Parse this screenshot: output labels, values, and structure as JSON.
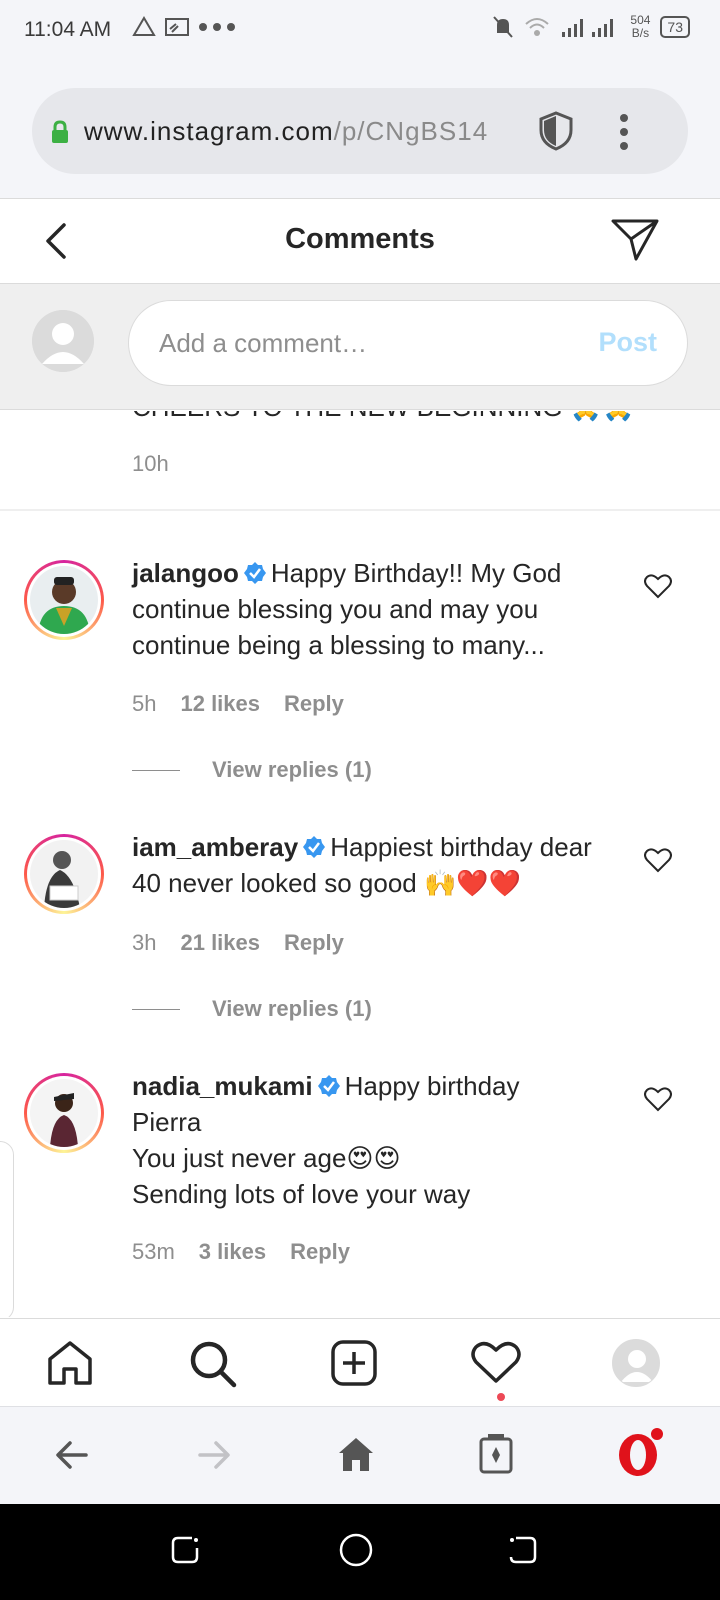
{
  "status_bar": {
    "time": "11:04 AM",
    "net_speed_value": "504",
    "net_speed_unit": "B/s",
    "battery": "73"
  },
  "browser": {
    "url_main": "www.instagram.com",
    "url_path": "/p/CNgBS14"
  },
  "header": {
    "title": "Comments"
  },
  "comment_input": {
    "placeholder": "Add a comment…",
    "post_label": "Post"
  },
  "truncated_comment": {
    "text": "CHEERS TO THE NEW BEGINNING 🙏🙏",
    "time": "10h"
  },
  "comments": [
    {
      "username": "jalangoo",
      "verified": true,
      "text": "Happy Birthday!! My God continue blessing you and may you continue being a blessing to many...",
      "time": "5h",
      "likes": "12 likes",
      "reply_label": "Reply",
      "view_replies": "View replies (1)"
    },
    {
      "username": "iam_amberay",
      "verified": true,
      "text": "Happiest birthday dear 40 never looked so good 🙌❤️❤️",
      "time": "3h",
      "likes": "21 likes",
      "reply_label": "Reply",
      "view_replies": "View replies (1)"
    },
    {
      "username": "nadia_mukami",
      "verified": true,
      "text_line1": "Happy birthday",
      "text_line2": "Pierra",
      "text_line3": "You just never age😍😍",
      "text_line4": "Sending lots of love your way",
      "time": "53m",
      "likes": "3 likes",
      "reply_label": "Reply"
    }
  ],
  "colors": {
    "accent_blue": "#3897f0",
    "post_disabled": "#b2dffc",
    "notification_red": "#ed4956",
    "opera_red": "#e0121b"
  },
  "icons": {
    "ig_nav": [
      "home-icon",
      "search-icon",
      "new-post-icon",
      "activity-heart-icon",
      "profile-avatar-icon"
    ],
    "browser_nav": [
      "back-arrow-icon",
      "forward-arrow-icon",
      "home-icon",
      "tabs-icon",
      "opera-menu-icon"
    ]
  }
}
